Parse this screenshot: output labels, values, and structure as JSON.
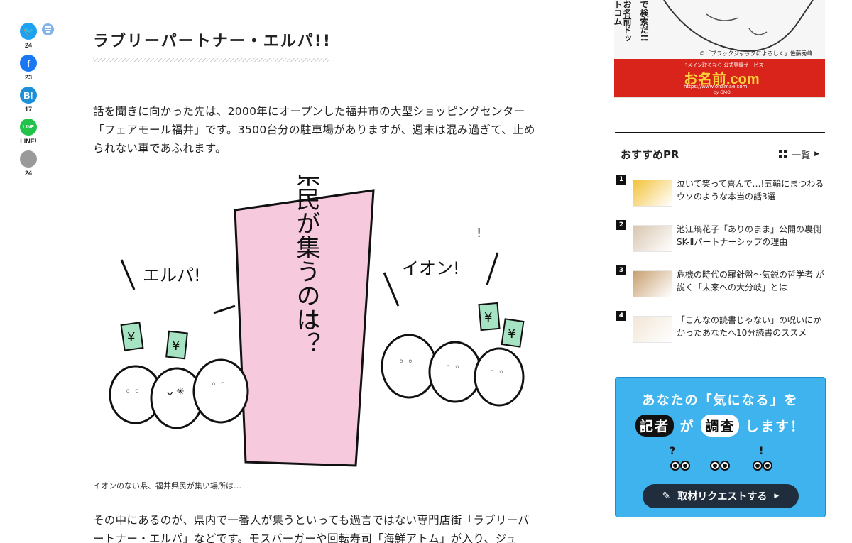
{
  "share": {
    "items": [
      {
        "name": "twitter",
        "icon": "twitter-bird-icon",
        "count": "24",
        "color": "#1da1f2"
      },
      {
        "name": "facebook",
        "icon": "facebook-icon",
        "count": "23",
        "color": "#1877f2"
      },
      {
        "name": "hatena",
        "icon": "hatena-bookmark-icon",
        "count": "17",
        "color": "#1b8fd8"
      },
      {
        "name": "line",
        "icon": "line-icon",
        "count": "LINE!",
        "color": "#22c34a"
      },
      {
        "name": "comment",
        "icon": "comment-bubble-icon",
        "count": "24",
        "color": "#9a9a9a"
      }
    ],
    "glyphs": {
      "twitter": "🐦",
      "facebook": "f",
      "hatena": "B!",
      "line": "LINE",
      "comment": ""
    }
  },
  "article": {
    "title": "ラブリーパートナー・エルパ!!",
    "para1": "話を聞きに向かった先は、2000年にオープンした福井市の大型ショッピングセンター「フェアモール福井」です。3500台分の駐車場がありますが、週末は混み過ぎて、止められない車であふれます。",
    "illustration": {
      "banner_text": "福井県民が集うのは？",
      "left_shout": "エルパ!",
      "right_shout": "イオン!"
    },
    "caption": "イオンのない県、福井県民が集い場所は…",
    "para2": "その中にあるのが、県内で一番人が集うといっても過言ではない専門店街「ラブリーパートナー・エルパ」などです。モスバーガーや回転寿司「海鮮アトム」が入り、ジュ"
  },
  "ad": {
    "vertical_text_1": "お名前ドットコム",
    "vertical_text_2": "で検索だ!!",
    "credit": "©「ブラックジャックによろしく」佐藤秀峰",
    "tagline": "ドメイン取るなら 公式登録サービス",
    "brand": "お名前.com",
    "url": "https://www.onamae.com",
    "maker": "by GMO",
    "accent": "#d9241b"
  },
  "pr": {
    "title": "おすすめPR",
    "all_label": "一覧",
    "items": [
      {
        "rank": "1",
        "text": "泣いて笑って喜んで…!五輪にまつわるウソのような本当の話3選"
      },
      {
        "rank": "2",
        "text": "池江璃花子「ありのまま」公開の裏側 SK-Ⅱパートナーシップの理由"
      },
      {
        "rank": "3",
        "text": "危機の時代の羅針盤〜気鋭の哲学者 が説く「未来への大分岐」とは"
      },
      {
        "rank": "4",
        "text": "「こんなの読書じゃない」の呪いにかかったあなたへ10分読書のススメ"
      }
    ]
  },
  "request": {
    "line1": "あなたの「気になる」を",
    "pill1": "記者",
    "mid1": "が",
    "pill2": "調査",
    "end": "します！",
    "button_label": "取材リクエストする",
    "bg": "#3fb3ee"
  }
}
